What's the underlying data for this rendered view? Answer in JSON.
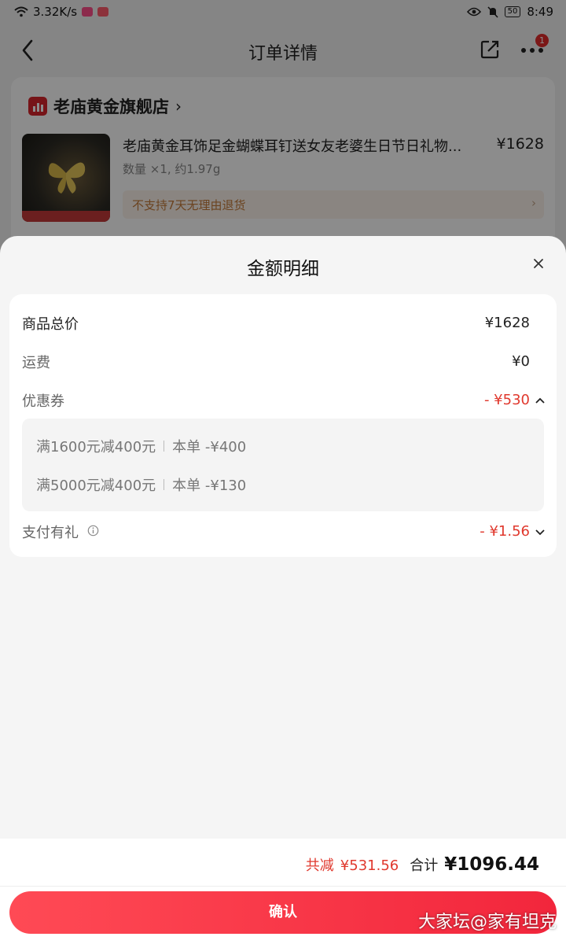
{
  "status_bar": {
    "speed": "3.32K/s",
    "battery": "50",
    "time": "8:49"
  },
  "nav": {
    "title": "订单详情",
    "more_badge": "1"
  },
  "order": {
    "shop_name": "老庙黄金旗舰店",
    "product_title": "老庙黄金耳饰足金蝴蝶耳钉送女友老婆生日节日礼物...",
    "price": "¥1628",
    "quantity": "数量 ×1, 约1.97g",
    "return_notice": "不支持7天无理由退货"
  },
  "sheet": {
    "title": "金额明细",
    "rows": {
      "goods_total": {
        "label": "商品总价",
        "value": "¥1628"
      },
      "shipping": {
        "label": "运费",
        "value": "¥0"
      },
      "coupon": {
        "label": "优惠券",
        "value": "- ¥530"
      },
      "payment_gift": {
        "label": "支付有礼",
        "value": "- ¥1.56"
      }
    },
    "coupons": [
      {
        "rule": "满1600元减400元",
        "amount": "本单 -¥400"
      },
      {
        "rule": "满5000元减400元",
        "amount": "本单 -¥130"
      }
    ]
  },
  "footer": {
    "reduce_label": "共减",
    "reduce_value": "¥531.56",
    "total_label": "合计",
    "total_value": "¥1096.44",
    "confirm_label": "确认"
  },
  "watermark": "大家坛@家有坦克",
  "colors": {
    "accent_red": "#e0382d",
    "button_red": "#f2263c"
  }
}
